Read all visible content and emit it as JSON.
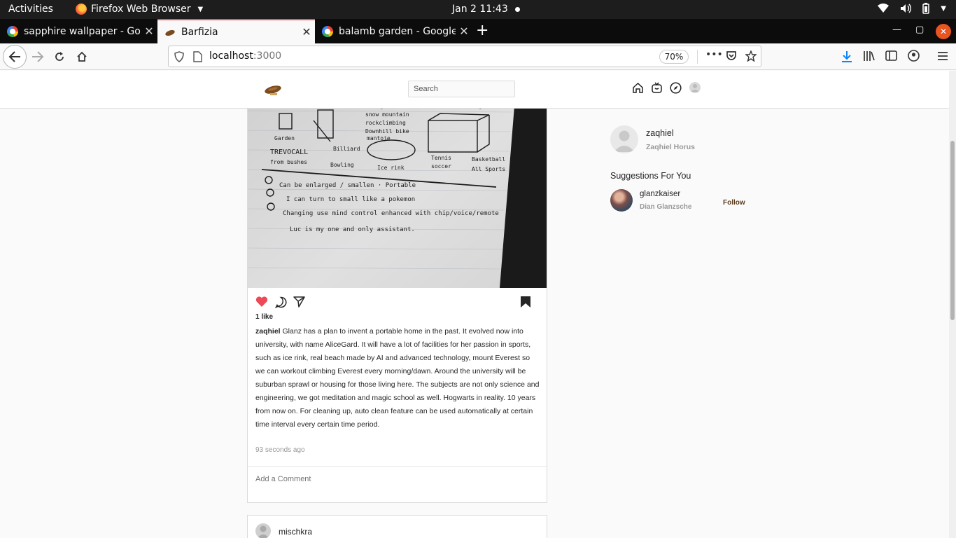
{
  "system_bar": {
    "activities": "Activities",
    "app_name": "Firefox Web Browser",
    "clock": "Jan 2  11:43"
  },
  "browser": {
    "tabs": [
      {
        "title": "sapphire wallpaper - Google",
        "icon": "google-icon"
      },
      {
        "title": "Barfizia",
        "icon": "barfizia-icon",
        "active": true
      },
      {
        "title": "balamb garden - Google",
        "icon": "google-icon"
      }
    ],
    "url_host": "localhost",
    "url_port": ":3000",
    "zoom": "70%"
  },
  "app": {
    "search_placeholder": "Search"
  },
  "post": {
    "likes": "1 like",
    "author": "zaqhiel",
    "caption": "Glanz has a plan to invent a portable home in the past. It evolved now into university, with name AliceGard. It will have a lot of facilities for her passion in sports, such as ice rink, real beach made by AI and advanced technology, mount Everest so we can workout climbing Everest every morning/dawn. Around the university will be suburban sprawl or housing for those living here. The subjects are not only science and engineering, we got meditation and magic school as well. Hogwarts in reality. 10 years from now on. For cleaning up, auto clean feature can be used automatically at certain time interval every certain time period.",
    "time_ago": "93 seconds ago",
    "comment_placeholder": "Add a Comment",
    "liked": true
  },
  "next_post": {
    "author": "mischkra"
  },
  "sidebar": {
    "username": "zaqhiel",
    "full_name": "Zaqhiel Horus",
    "suggestions_title": "Suggestions For You",
    "suggestions": [
      {
        "username": "glanzkaiser",
        "full_name": "Dian Glanzsche",
        "action": "Follow"
      }
    ]
  },
  "colors": {
    "like_red": "#ed4956",
    "active_tab_accent": "#ff4f5e",
    "download_blue": "#0a84ff",
    "follow_brown": "#5b3a1a"
  }
}
